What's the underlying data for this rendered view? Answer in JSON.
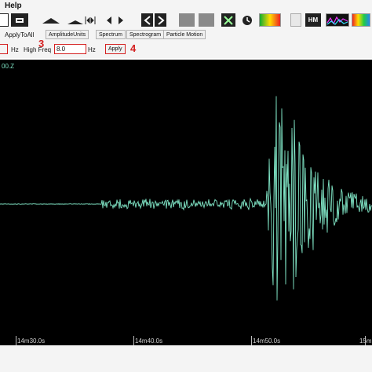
{
  "menu": {
    "help": "Help"
  },
  "toolbar": {
    "icons": [
      "save-icon",
      "print-icon",
      "stretch-icon",
      "compress-icon",
      "zoom-fit-icon",
      "pan-left-icon",
      "pan-right-icon",
      "nav-prev-icon",
      "nav-next-icon",
      "grid-view-icon",
      "list-view-icon",
      "pick-icon",
      "history-icon",
      "color-spectrum-icon",
      "paper-icon",
      "hm-icon",
      "waves-icon",
      "color-bars-icon"
    ],
    "hm_label": "HM"
  },
  "controls": {
    "apply_to_all": "ApplyToAll",
    "amplitude_units": "AmplitudeUnits",
    "spectrum": "Spectrum",
    "spectrogram": "Spectrogram",
    "particle_motion": "Particle Motion"
  },
  "filter": {
    "low_unit": "Hz",
    "high_freq_label": "High Freq",
    "high_freq_value": "8.0",
    "high_unit": "Hz",
    "apply": "Apply",
    "step3": "3",
    "step4": "4"
  },
  "plot": {
    "channel_label": "00.Z",
    "background": "#000000",
    "trace_color": "#7fe3c4"
  },
  "time_axis": {
    "labels": [
      "14m30.0s",
      "14m40.0s",
      "14m50.0s",
      "15m"
    ]
  }
}
